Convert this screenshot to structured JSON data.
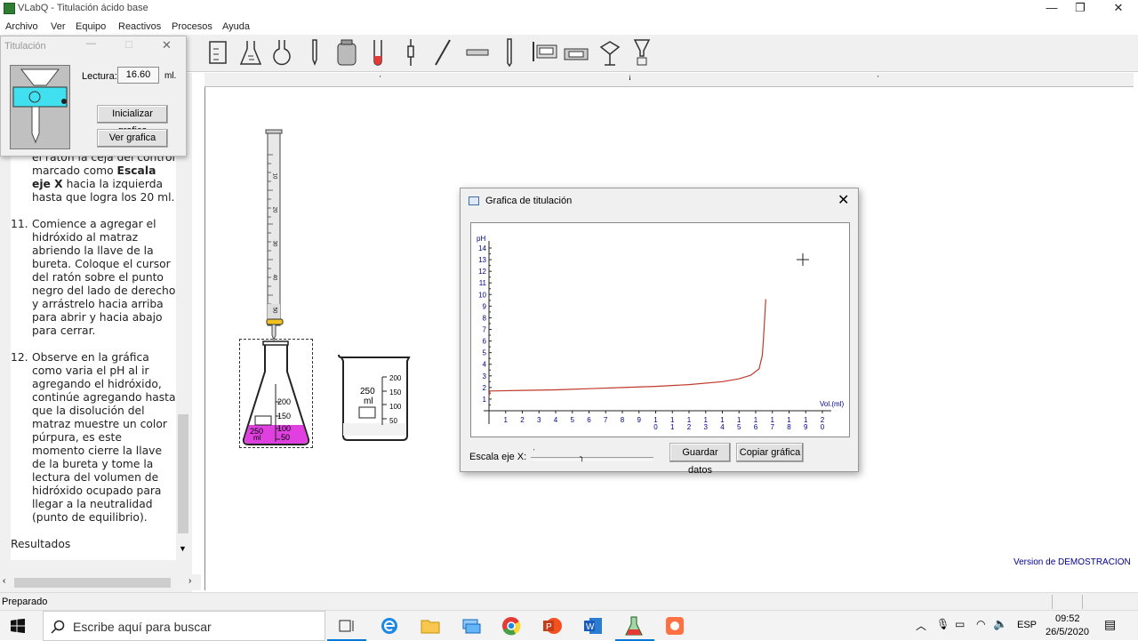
{
  "window": {
    "title": "VLabQ - Titulación ácido base",
    "controls": [
      "minimize-icon",
      "restore-icon",
      "close-icon"
    ]
  },
  "menu": [
    "Archivo",
    "Ver",
    "Equipo",
    "Reactivos",
    "Procesos",
    "Ayuda"
  ],
  "toolbar": {
    "tools": [
      "beaker-tool",
      "graduated-beaker-tool",
      "erlenmeyer-tool",
      "round-flask-tool",
      "thermometer-tool",
      "container-tool",
      "test-tube-tool",
      "pipette-tool",
      "rod-tool",
      "ph-strip-tool",
      "burette-tool",
      "ph-meter-tool",
      "balance-tool",
      "stand-tool",
      "funnel-tool"
    ]
  },
  "titulacion_panel": {
    "title": "Titulación",
    "lectura_label": "Lectura:",
    "lectura_value": "16.60",
    "lectura_unit": "ml.",
    "init_button": "Inicializar grafica",
    "view_button": "Ver grafica"
  },
  "instructions": {
    "partial_top_line": "el ratón la ceja del control marcado como",
    "bold_term": "Escala eje X",
    "partial_rest": "hacia la izquierda hasta que logra los 20 ml.",
    "items": [
      {
        "num": "11.",
        "text": "Comience a agregar el hidróxido al matraz abriendo la llave de la bureta. Coloque el cursor del ratón sobre el punto negro del lado de derecho y arrástrelo hacia arriba para abrir y hacia abajo para cerrar."
      },
      {
        "num": "12.",
        "text": "Observe en la gráfica como varia el pH al ir agregando el hidróxido, continúe agregando hasta que la disolución del matraz muestre un color púrpura, es este momento cierre la llave de la bureta y tome la lectura del volumen de hidróxido ocupado para llegar a la neutralidad (punto de equilibrio)."
      }
    ],
    "cut_off_line": "Resultados"
  },
  "apparatus": {
    "burette_marks": [
      "10",
      "20",
      "30",
      "40",
      "50"
    ],
    "flask": {
      "volume": "250",
      "unit": "ml",
      "marks": [
        "200",
        "150",
        "100",
        "50"
      ],
      "liquid_color": "#e040e0"
    },
    "beaker": {
      "volume": "250",
      "unit": "ml",
      "marks": [
        "200",
        "150",
        "100",
        "50"
      ]
    }
  },
  "graph_window": {
    "title": "Grafica de titulación",
    "escala_label": "Escala eje X:",
    "save_button": "Guardar datos",
    "copy_button": "Copiar gráfica"
  },
  "chart_data": {
    "type": "line",
    "title": "",
    "ylabel": "pH",
    "xlabel": "Vol.(ml)",
    "xlim": [
      0,
      20
    ],
    "ylim": [
      0,
      14
    ],
    "x_ticks": [
      "1",
      "2",
      "3",
      "4",
      "5",
      "6",
      "7",
      "8",
      "9",
      "10",
      "11",
      "12",
      "13",
      "14",
      "15",
      "16",
      "17",
      "18",
      "19",
      "20"
    ],
    "y_ticks": [
      "1",
      "2",
      "3",
      "4",
      "5",
      "6",
      "7",
      "8",
      "9",
      "10",
      "11",
      "12",
      "13",
      "14"
    ],
    "series": [
      {
        "color": "#c0392b",
        "x": [
          0,
          0.05,
          2,
          4,
          6,
          8,
          10,
          12,
          14,
          15,
          15.7,
          16.2,
          16.4,
          16.5,
          16.6
        ],
        "y": [
          1.2,
          1.7,
          1.75,
          1.8,
          1.9,
          2.0,
          2.1,
          2.25,
          2.5,
          2.75,
          3.05,
          3.6,
          4.8,
          7.0,
          9.6
        ]
      }
    ]
  },
  "version_text": "Version de DEMOSTRACION",
  "status": "Preparado",
  "taskbar": {
    "search_placeholder": "Escribe aquí para buscar",
    "apps": [
      "task-view",
      "edge",
      "file-explorer",
      "network-app",
      "chrome",
      "powerpoint",
      "word",
      "vlabq",
      "recorder"
    ],
    "lang": "ESP",
    "time": "09:52",
    "date": "26/5/2020"
  }
}
